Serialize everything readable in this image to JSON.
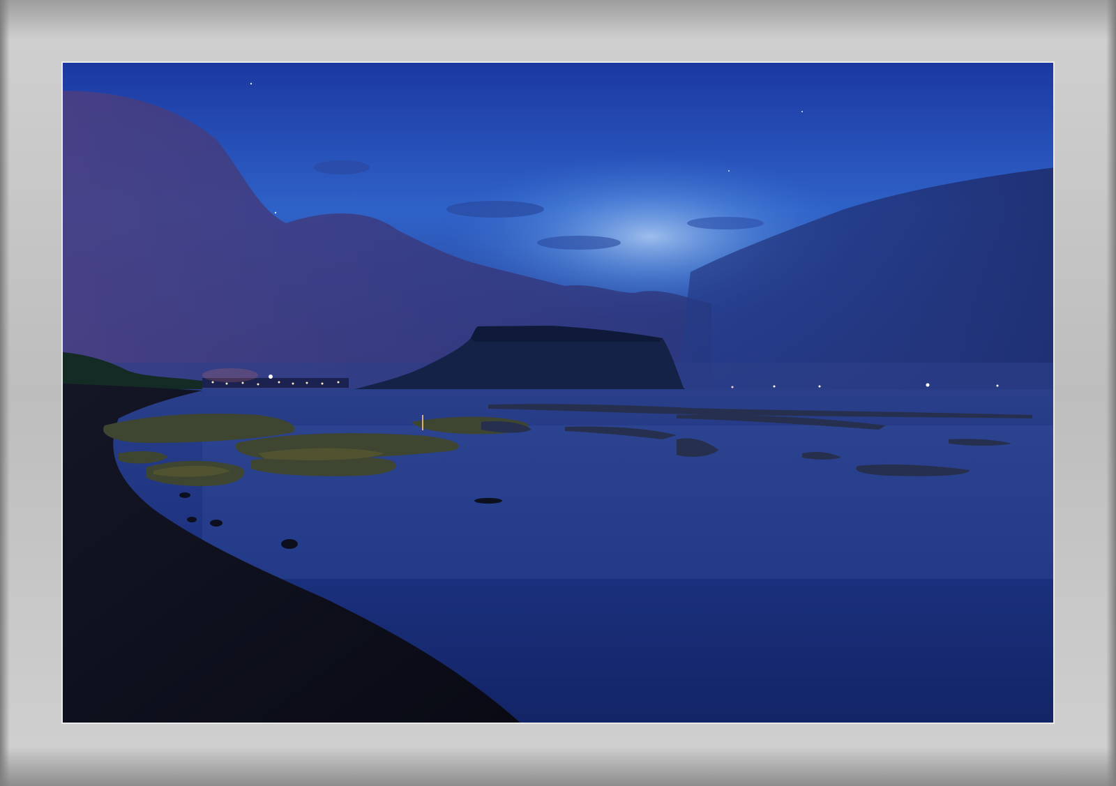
{
  "image": {
    "subject": "seaside-dusk-with-flat-topped-headland",
    "colors": {
      "sky_top": "#1e3ea8",
      "sky_mid": "#3a78d8",
      "sky_glow": "#8fb6ee",
      "clouds": "#2c2f6e",
      "headland": "#122046",
      "sea": "#1a2f7a",
      "beach": "#0d0f1e",
      "rocks": "#4a5030",
      "frame": "#bdbdbd",
      "frame_border": "#eaeaea"
    }
  }
}
